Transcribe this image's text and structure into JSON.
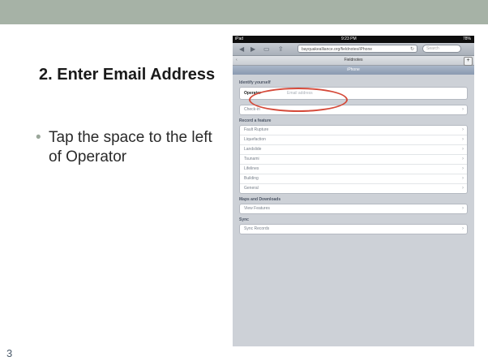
{
  "slide": {
    "title": "2. Enter Email Address",
    "bullet": "Tap the space to the left of Operator",
    "page_number": "3"
  },
  "ipad": {
    "status": {
      "carrier": "iPad",
      "time": "9:23 PM",
      "battery": "78%"
    },
    "url": "bayquakealliance.org/fieldnotes/iPhone",
    "search_placeholder": "Search",
    "tab_title": "Fieldnotes",
    "nav_title": "iPhone",
    "identify": {
      "header": "Identify yourself",
      "operator_label": "Operator",
      "email_placeholder": "Email address",
      "checkin": "Check-in"
    },
    "record": {
      "header": "Record a feature",
      "items": [
        "Fault Rupture",
        "Liquefaction",
        "Landslide",
        "Tsunami",
        "Lifelines",
        "Building",
        "General"
      ]
    },
    "maps": {
      "header": "Maps and Downloads",
      "items": [
        "View Features"
      ]
    },
    "sync": {
      "header": "Sync",
      "items": [
        "Sync Records"
      ]
    }
  },
  "colors": {
    "topbar": "#a6b2a6",
    "highlight": "#d54a3a",
    "nav": "#8a9ab1"
  }
}
